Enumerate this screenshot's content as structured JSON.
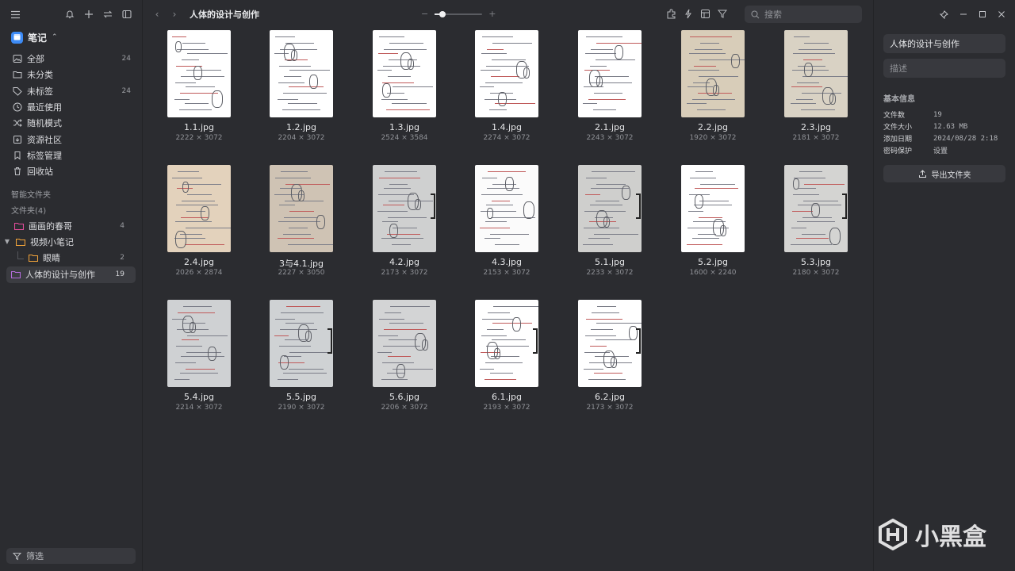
{
  "sidebar": {
    "library": "笔记",
    "nav": [
      {
        "label": "全部",
        "count": "24",
        "icon": "image-icon"
      },
      {
        "label": "未分类",
        "count": "",
        "icon": "folder-icon"
      },
      {
        "label": "未标签",
        "count": "24",
        "icon": "tag-icon"
      },
      {
        "label": "最近使用",
        "count": "",
        "icon": "clock-icon"
      },
      {
        "label": "随机模式",
        "count": "",
        "icon": "shuffle-icon"
      },
      {
        "label": "资源社区",
        "count": "",
        "icon": "community-icon"
      },
      {
        "label": "标签管理",
        "count": "",
        "icon": "bookmark-icon"
      },
      {
        "label": "回收站",
        "count": "",
        "icon": "trash-icon"
      }
    ],
    "smart_folders_title": "智能文件夹",
    "folders_title": "文件夹(4)",
    "folders": [
      {
        "label": "画画的春哥",
        "count": "4",
        "color": "#e24c9a"
      },
      {
        "label": "视频小笔记",
        "count": "",
        "color": "#f0a23a"
      },
      {
        "label": "眼睛",
        "count": "2",
        "color": "#f0a23a"
      },
      {
        "label": "人体的设计与创作",
        "count": "19",
        "color": "#b36cdb"
      }
    ],
    "filter_label": "筛选"
  },
  "main": {
    "title": "人体的设计与创作",
    "zoom": 0.16,
    "search_placeholder": "搜索",
    "items": [
      {
        "name": "1.1.jpg",
        "dims": "2222 × 3072"
      },
      {
        "name": "1.2.jpg",
        "dims": "2204 × 3072"
      },
      {
        "name": "1.3.jpg",
        "dims": "2524 × 3584"
      },
      {
        "name": "1.4.jpg",
        "dims": "2274 × 3072"
      },
      {
        "name": "2.1.jpg",
        "dims": "2243 × 3072"
      },
      {
        "name": "2.2.jpg",
        "dims": "1920 × 3072"
      },
      {
        "name": "2.3.jpg",
        "dims": "2181 × 3072"
      },
      {
        "name": "2.4.jpg",
        "dims": "2026 × 2874"
      },
      {
        "name": "3与4.1.jpg",
        "dims": "2227 × 3050"
      },
      {
        "name": "4.2.jpg",
        "dims": "2173 × 3072"
      },
      {
        "name": "4.3.jpg",
        "dims": "2153 × 3072"
      },
      {
        "name": "5.1.jpg",
        "dims": "2233 × 3072"
      },
      {
        "name": "5.2.jpg",
        "dims": "1600 × 2240"
      },
      {
        "name": "5.3.jpg",
        "dims": "2180 × 3072"
      },
      {
        "name": "5.4.jpg",
        "dims": "2214 × 3072"
      },
      {
        "name": "5.5.jpg",
        "dims": "2190 × 3072"
      },
      {
        "name": "5.6.jpg",
        "dims": "2206 × 3072"
      },
      {
        "name": "6.1.jpg",
        "dims": "2193 × 3072"
      },
      {
        "name": "6.2.jpg",
        "dims": "2173 × 3072"
      }
    ]
  },
  "panel": {
    "name_value": "人体的设计与创作",
    "desc_placeholder": "描述",
    "info_title": "基本信息",
    "rows": [
      {
        "k": "文件数",
        "v": "19"
      },
      {
        "k": "文件大小",
        "v": "12.63 MB"
      },
      {
        "k": "添加日期",
        "v": "2024/08/28 2:18"
      },
      {
        "k": "密码保护",
        "v": "设置"
      }
    ],
    "export_label": "导出文件夹"
  },
  "watermark": "小黑盒"
}
